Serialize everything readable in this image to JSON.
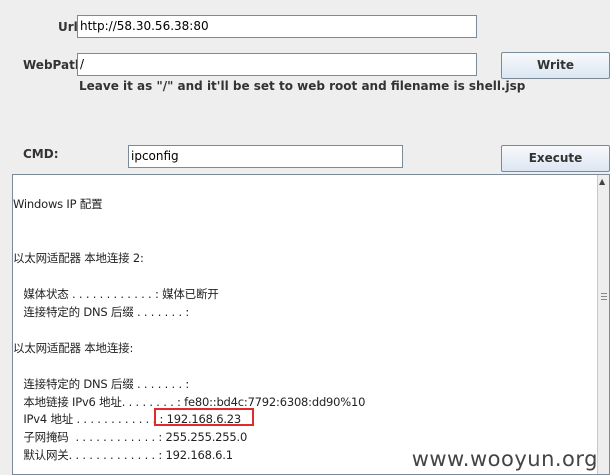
{
  "form": {
    "url_label": "Url:",
    "url_value": "http://58.30.56.38:80",
    "webpath_label": "WebPath:",
    "webpath_value": "/",
    "write_button": "Write",
    "hint": "Leave it as \"/\" and it'll be set to web root and filename is shell.jsp",
    "cmd_label": "CMD:",
    "cmd_value": "ipconfig",
    "execute_button": "Execute"
  },
  "output": {
    "lines": [
      "Windows IP 配置",
      "以太网适配器 本地连接 2:",
      "   媒体状态 . . . . . . . . . . . . : 媒体已断开",
      "   连接特定的 DNS 后缀 . . . . . . . :",
      "以太网适配器 本地连接:",
      "   连接特定的 DNS 后缀 . . . . . . . :",
      "   本地链接 IPv6 地址. . . . . . . . : fe80::bd4c:7792:6308:dd90%10",
      "   IPv4 地址 . . . . . . . . . . . . : 192.168.6.23",
      "   子网掩码  . . . . . . . . . . . . : 255.255.255.0",
      "   默认网关. . . . . . . . . . . . . : 192.168.6.1"
    ]
  },
  "watermark": "www.wooyun.org",
  "colors": {
    "highlight": "#e02b2b"
  }
}
